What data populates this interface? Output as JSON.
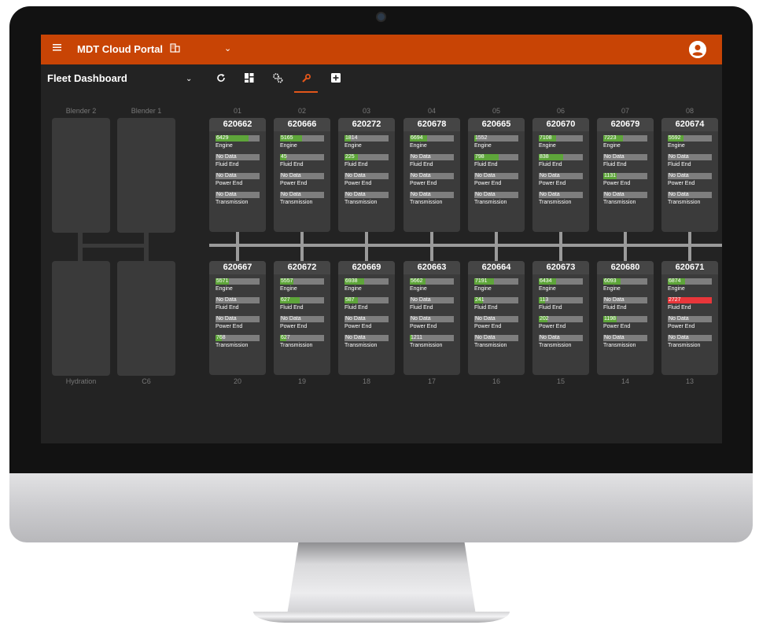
{
  "app": {
    "title": "MDT Cloud Portal",
    "dashboard_title": "Fleet Dashboard",
    "accent": "#c84405"
  },
  "toolbar": {
    "icons": [
      "refresh-icon",
      "dashboard-layout-icon",
      "gears-icon",
      "wrench-icon",
      "add-box-icon"
    ],
    "active": "wrench-icon"
  },
  "equipment": {
    "blender2": "Blender 2",
    "blender1": "Blender 1",
    "hydration": "Hydration",
    "c6": "C6"
  },
  "top_row": [
    {
      "slot": "01",
      "unit": "620662",
      "metrics": [
        {
          "label": "Engine",
          "value": "6429",
          "fill": 0.75,
          "status": "green"
        },
        {
          "label": "Fluid End",
          "value": "No Data",
          "fill": 0,
          "status": "none"
        },
        {
          "label": "Power End",
          "value": "No Data",
          "fill": 0,
          "status": "none"
        },
        {
          "label": "Transmission",
          "value": "No Data",
          "fill": 0,
          "status": "none"
        }
      ]
    },
    {
      "slot": "02",
      "unit": "620666",
      "metrics": [
        {
          "label": "Engine",
          "value": "5165",
          "fill": 0.5,
          "status": "green"
        },
        {
          "label": "Fluid End",
          "value": "45",
          "fill": 0.15,
          "status": "green"
        },
        {
          "label": "Power End",
          "value": "No Data",
          "fill": 0,
          "status": "none"
        },
        {
          "label": "Transmission",
          "value": "No Data",
          "fill": 0,
          "status": "none"
        }
      ]
    },
    {
      "slot": "03",
      "unit": "620272",
      "metrics": [
        {
          "label": "Engine",
          "value": "1814",
          "fill": 0.15,
          "status": "green"
        },
        {
          "label": "Fluid End",
          "value": "225",
          "fill": 0.3,
          "status": "green"
        },
        {
          "label": "Power End",
          "value": "No Data",
          "fill": 0,
          "status": "none"
        },
        {
          "label": "Transmission",
          "value": "No Data",
          "fill": 0,
          "status": "none"
        }
      ]
    },
    {
      "slot": "04",
      "unit": "620678",
      "metrics": [
        {
          "label": "Engine",
          "value": "6694",
          "fill": 0.4,
          "status": "green"
        },
        {
          "label": "Fluid End",
          "value": "No Data",
          "fill": 0,
          "status": "none"
        },
        {
          "label": "Power End",
          "value": "No Data",
          "fill": 0,
          "status": "none"
        },
        {
          "label": "Transmission",
          "value": "No Data",
          "fill": 0,
          "status": "none"
        }
      ]
    },
    {
      "slot": "05",
      "unit": "620665",
      "metrics": [
        {
          "label": "Engine",
          "value": "1552",
          "fill": 0.05,
          "status": "green"
        },
        {
          "label": "Fluid End",
          "value": "798",
          "fill": 0.55,
          "status": "green"
        },
        {
          "label": "Power End",
          "value": "No Data",
          "fill": 0,
          "status": "none"
        },
        {
          "label": "Transmission",
          "value": "No Data",
          "fill": 0,
          "status": "none"
        }
      ]
    },
    {
      "slot": "06",
      "unit": "620670",
      "metrics": [
        {
          "label": "Engine",
          "value": "7108",
          "fill": 0.4,
          "status": "green"
        },
        {
          "label": "Fluid End",
          "value": "838",
          "fill": 0.55,
          "status": "green"
        },
        {
          "label": "Power End",
          "value": "No Data",
          "fill": 0,
          "status": "none"
        },
        {
          "label": "Transmission",
          "value": "No Data",
          "fill": 0,
          "status": "none"
        }
      ]
    },
    {
      "slot": "07",
      "unit": "620679",
      "metrics": [
        {
          "label": "Engine",
          "value": "7223",
          "fill": 0.45,
          "status": "green"
        },
        {
          "label": "Fluid End",
          "value": "No Data",
          "fill": 0,
          "status": "none"
        },
        {
          "label": "Power End",
          "value": "1131",
          "fill": 0.3,
          "status": "green"
        },
        {
          "label": "Transmission",
          "value": "No Data",
          "fill": 0,
          "status": "none"
        }
      ]
    },
    {
      "slot": "08",
      "unit": "620674",
      "metrics": [
        {
          "label": "Engine",
          "value": "5592",
          "fill": 0.35,
          "status": "green"
        },
        {
          "label": "Fluid End",
          "value": "No Data",
          "fill": 0,
          "status": "none"
        },
        {
          "label": "Power End",
          "value": "No Data",
          "fill": 0,
          "status": "none"
        },
        {
          "label": "Transmission",
          "value": "No Data",
          "fill": 0,
          "status": "none"
        }
      ]
    }
  ],
  "bottom_row": [
    {
      "slot": "20",
      "unit": "620667",
      "metrics": [
        {
          "label": "Engine",
          "value": "5571",
          "fill": 0.3,
          "status": "green"
        },
        {
          "label": "Fluid End",
          "value": "No Data",
          "fill": 0,
          "status": "none"
        },
        {
          "label": "Power End",
          "value": "No Data",
          "fill": 0,
          "status": "none"
        },
        {
          "label": "Transmission",
          "value": "768",
          "fill": 0.15,
          "status": "green"
        }
      ]
    },
    {
      "slot": "19",
      "unit": "620672",
      "metrics": [
        {
          "label": "Engine",
          "value": "5557",
          "fill": 0.3,
          "status": "green"
        },
        {
          "label": "Fluid End",
          "value": "627",
          "fill": 0.45,
          "status": "green"
        },
        {
          "label": "Power End",
          "value": "No Data",
          "fill": 0,
          "status": "none"
        },
        {
          "label": "Transmission",
          "value": "627",
          "fill": 0.15,
          "status": "green"
        }
      ]
    },
    {
      "slot": "18",
      "unit": "620669",
      "metrics": [
        {
          "label": "Engine",
          "value": "6938",
          "fill": 0.45,
          "status": "green"
        },
        {
          "label": "Fluid End",
          "value": "587",
          "fill": 0.3,
          "status": "green"
        },
        {
          "label": "Power End",
          "value": "No Data",
          "fill": 0,
          "status": "none"
        },
        {
          "label": "Transmission",
          "value": "No Data",
          "fill": 0,
          "status": "none"
        }
      ]
    },
    {
      "slot": "17",
      "unit": "620663",
      "metrics": [
        {
          "label": "Engine",
          "value": "5662",
          "fill": 0.35,
          "status": "green"
        },
        {
          "label": "Fluid End",
          "value": "No Data",
          "fill": 0,
          "status": "none"
        },
        {
          "label": "Power End",
          "value": "No Data",
          "fill": 0,
          "status": "none"
        },
        {
          "label": "Transmission",
          "value": "1211",
          "fill": 0.05,
          "status": "green"
        }
      ]
    },
    {
      "slot": "16",
      "unit": "620664",
      "metrics": [
        {
          "label": "Engine",
          "value": "7191",
          "fill": 0.45,
          "status": "green"
        },
        {
          "label": "Fluid End",
          "value": "241",
          "fill": 0.2,
          "status": "green"
        },
        {
          "label": "Power End",
          "value": "No Data",
          "fill": 0,
          "status": "none"
        },
        {
          "label": "Transmission",
          "value": "No Data",
          "fill": 0,
          "status": "none"
        }
      ]
    },
    {
      "slot": "15",
      "unit": "620673",
      "metrics": [
        {
          "label": "Engine",
          "value": "6434",
          "fill": 0.4,
          "status": "green"
        },
        {
          "label": "Fluid End",
          "value": "113",
          "fill": 0.15,
          "status": "green"
        },
        {
          "label": "Power End",
          "value": "202",
          "fill": 0.2,
          "status": "green"
        },
        {
          "label": "Transmission",
          "value": "No Data",
          "fill": 0,
          "status": "none"
        }
      ]
    },
    {
      "slot": "14",
      "unit": "620680",
      "metrics": [
        {
          "label": "Engine",
          "value": "6093",
          "fill": 0.4,
          "status": "green"
        },
        {
          "label": "Fluid End",
          "value": "No Data",
          "fill": 0,
          "status": "none"
        },
        {
          "label": "Power End",
          "value": "1198",
          "fill": 0.3,
          "status": "green"
        },
        {
          "label": "Transmission",
          "value": "No Data",
          "fill": 0,
          "status": "none"
        }
      ]
    },
    {
      "slot": "13",
      "unit": "620671",
      "metrics": [
        {
          "label": "Engine",
          "value": "6874",
          "fill": 0.4,
          "status": "green"
        },
        {
          "label": "Fluid End",
          "value": "2727",
          "fill": 1,
          "status": "red"
        },
        {
          "label": "Power End",
          "value": "No Data",
          "fill": 0,
          "status": "none"
        },
        {
          "label": "Transmission",
          "value": "No Data",
          "fill": 0,
          "status": "none"
        }
      ]
    }
  ]
}
